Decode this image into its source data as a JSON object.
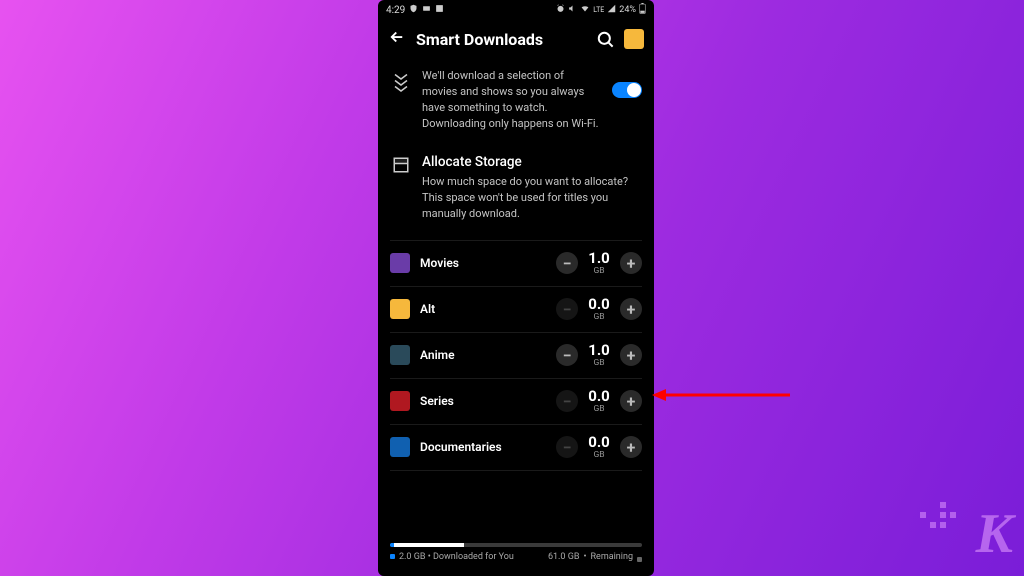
{
  "status_bar": {
    "time": "4:29",
    "battery": "24%"
  },
  "header": {
    "title": "Smart Downloads"
  },
  "smart_downloads": {
    "description": "We'll download a selection of movies and shows so you always have something to watch. Downloading only happens on Wi-Fi.",
    "enabled": true
  },
  "allocate": {
    "title": "Allocate Storage",
    "description": "How much space do you want to allocate? This space won't be used for titles you manually download."
  },
  "categories": [
    {
      "name": "Movies",
      "value": "1.0",
      "unit": "GB",
      "thumb": "#6a3ca8",
      "can_decrease": true
    },
    {
      "name": "Alt",
      "value": "0.0",
      "unit": "GB",
      "thumb": "#f6b83c",
      "can_decrease": false
    },
    {
      "name": "Anime",
      "value": "1.0",
      "unit": "GB",
      "thumb": "#2a4a5a",
      "can_decrease": true
    },
    {
      "name": "Series",
      "value": "0.0",
      "unit": "GB",
      "thumb": "#b01820",
      "can_decrease": false
    },
    {
      "name": "Documentaries",
      "value": "0.0",
      "unit": "GB",
      "thumb": "#1060b0",
      "can_decrease": false
    }
  ],
  "storage": {
    "downloaded_value": "2.0 GB",
    "downloaded_label": "Downloaded for You",
    "remaining_value": "61.0 GB",
    "remaining_label": "Remaining"
  }
}
